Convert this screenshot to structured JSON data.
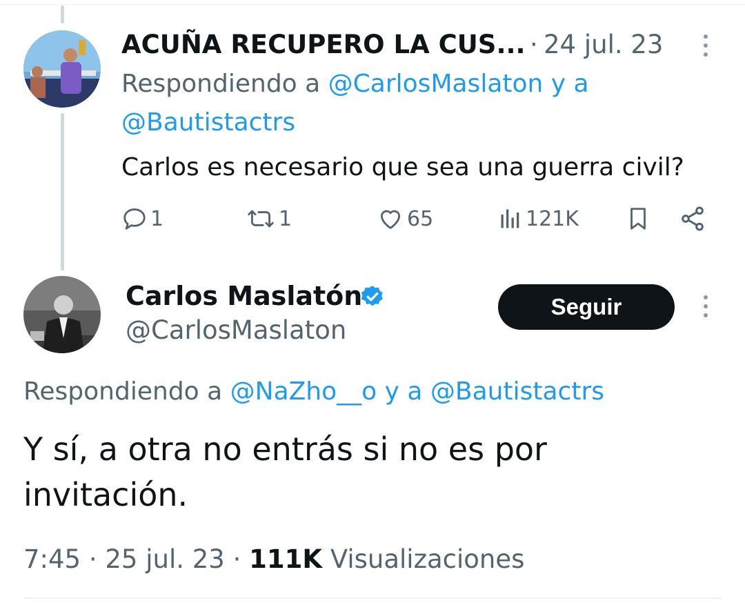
{
  "reply": {
    "author_name": "ACUÑA RECUPERO LA CUS...",
    "date_sep": "·",
    "date": "24 jul. 23",
    "replying_prefix": "Respondiendo a",
    "replying_user1": "@CarlosMaslaton",
    "replying_and": "y a",
    "replying_user2": "@Bautistactrs",
    "text": "Carlos es necesario que sea una guerra civil?",
    "actions": {
      "replies": "1",
      "retweets": "1",
      "likes": "65",
      "views": "121K"
    }
  },
  "main": {
    "author_name": "Carlos Maslatón",
    "handle": "@CarlosMaslaton",
    "follow_label": "Seguir",
    "replying_prefix": "Respondiendo a",
    "replying_user1": "@NaZho__o",
    "replying_and": "y a",
    "replying_user2": "@Bautistactrs",
    "text_line1": "Y sí, a otra no entrás si no es por",
    "text_line2": "invitación.",
    "time": "7:45",
    "sep1": "·",
    "date": "25 jul. 23",
    "sep2": "·",
    "views_count": "111K",
    "views_label": "Visualizaciones"
  },
  "colors": {
    "link": "#1d9bf0",
    "muted": "#536471",
    "text": "#0f1419",
    "verified": "#1d9bf0"
  }
}
